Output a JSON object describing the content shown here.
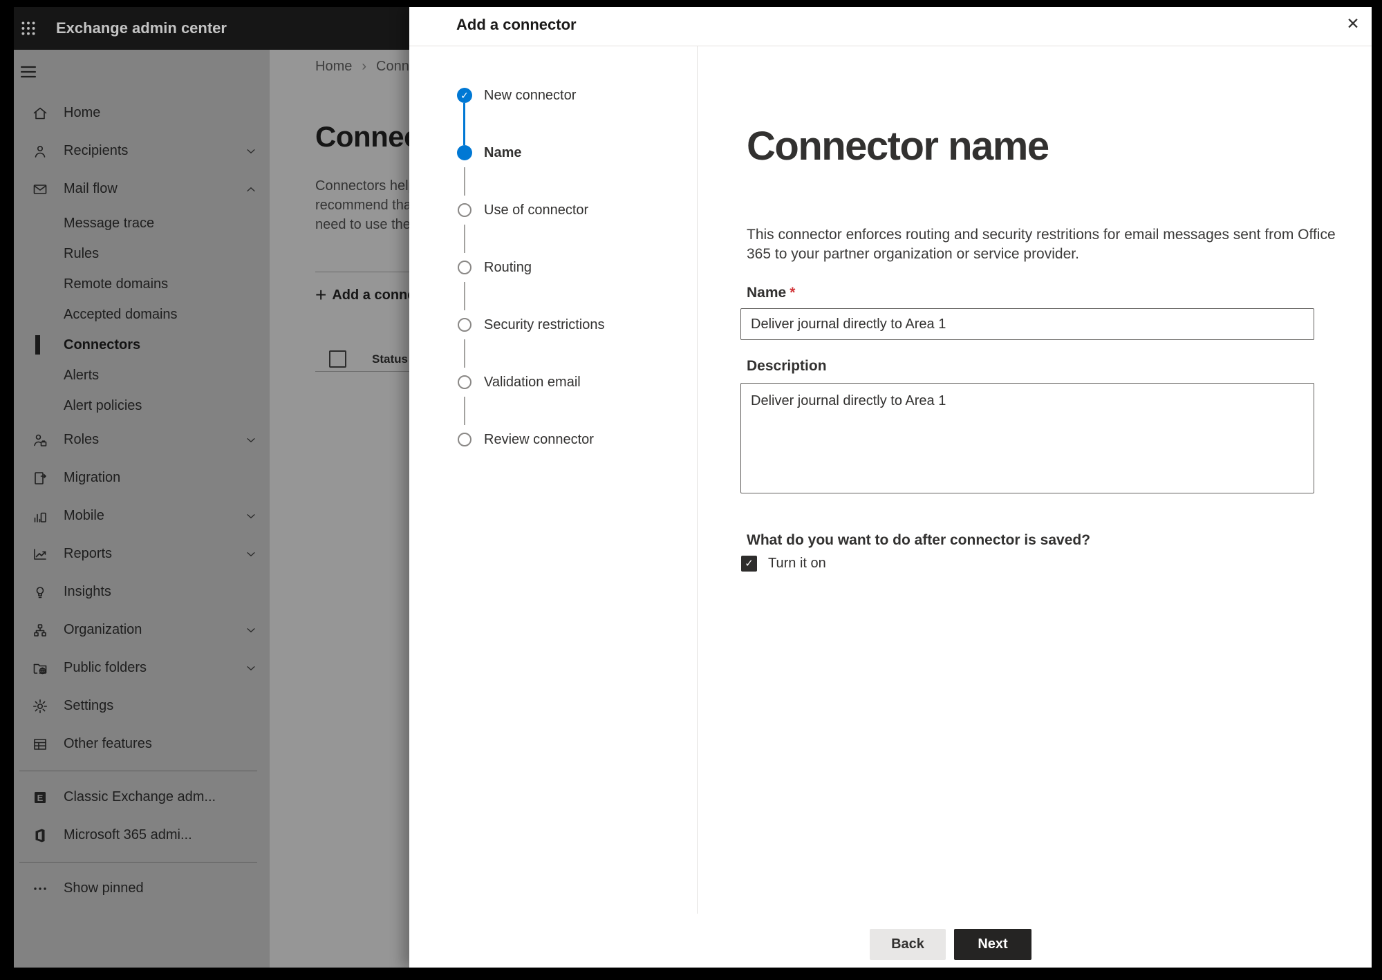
{
  "topbar": {
    "title": "Exchange admin center",
    "app_launcher_icon": "waffle-icon"
  },
  "sidebar": {
    "menu_icon": "hamburger-icon",
    "items": [
      {
        "icon": "home-icon",
        "label": "Home"
      },
      {
        "icon": "recipients-icon",
        "label": "Recipients",
        "chevron": "down"
      },
      {
        "icon": "mail-flow-icon",
        "label": "Mail flow",
        "chevron": "up"
      },
      {
        "label": "Message trace",
        "sub": true
      },
      {
        "label": "Rules",
        "sub": true
      },
      {
        "label": "Remote domains",
        "sub": true
      },
      {
        "label": "Accepted domains",
        "sub": true
      },
      {
        "label": "Connectors",
        "sub": true,
        "selected": true
      },
      {
        "label": "Alerts",
        "sub": true
      },
      {
        "label": "Alert policies",
        "sub": true
      },
      {
        "icon": "roles-icon",
        "label": "Roles",
        "chevron": "down"
      },
      {
        "icon": "migration-icon",
        "label": "Migration"
      },
      {
        "icon": "mobile-icon",
        "label": "Mobile",
        "chevron": "down"
      },
      {
        "icon": "reports-icon",
        "label": "Reports",
        "chevron": "down"
      },
      {
        "icon": "insights-icon",
        "label": "Insights"
      },
      {
        "icon": "organization-icon",
        "label": "Organization",
        "chevron": "down"
      },
      {
        "icon": "public-folders-icon",
        "label": "Public folders",
        "chevron": "down"
      },
      {
        "icon": "settings-icon",
        "label": "Settings"
      },
      {
        "icon": "other-features-icon",
        "label": "Other features"
      },
      {
        "divider": true
      },
      {
        "icon": "classic-exchange-icon",
        "label": "Classic Exchange adm..."
      },
      {
        "icon": "microsoft-365-icon",
        "label": "Microsoft 365 admi..."
      },
      {
        "divider": true
      },
      {
        "icon": "show-pinned-icon",
        "label": "Show pinned"
      }
    ]
  },
  "background_page": {
    "breadcrumb": {
      "home": "Home",
      "current": "Connectors"
    },
    "heading": "Connectors",
    "intro_lines": [
      "Connectors help",
      "recommend that",
      "need to use them"
    ],
    "add_button_label": "Add a connector",
    "table": {
      "status_header": "Status"
    }
  },
  "modal": {
    "title": "Add a connector",
    "steps": [
      {
        "label": "New connector",
        "state": "done"
      },
      {
        "label": "Name",
        "state": "current"
      },
      {
        "label": "Use of connector",
        "state": "upcoming"
      },
      {
        "label": "Routing",
        "state": "upcoming"
      },
      {
        "label": "Security restrictions",
        "state": "upcoming"
      },
      {
        "label": "Validation email",
        "state": "upcoming"
      },
      {
        "label": "Review connector",
        "state": "upcoming"
      }
    ],
    "content": {
      "heading": "Connector name",
      "description": "This connector enforces routing and security restritions for email messages sent from Office 365 to your partner organization or service provider.",
      "name_label": "Name",
      "required_mark": "*",
      "name_value": "Deliver journal directly to Area 1",
      "description_label": "Description",
      "description_value": "Deliver journal directly to Area 1",
      "after_save_question": "What do you want to do after connector is saved?",
      "turn_on_label": "Turn it on",
      "turn_on_checked": true
    },
    "footer": {
      "back_label": "Back",
      "next_label": "Next"
    }
  },
  "glyphs": {
    "close": "✕",
    "check": "✓",
    "plus": "+",
    "breadcrumb_separator": "›"
  },
  "colors": {
    "accent_blue": "#0078d4",
    "required_red": "#d13438",
    "next_button_bg": "#252423"
  }
}
